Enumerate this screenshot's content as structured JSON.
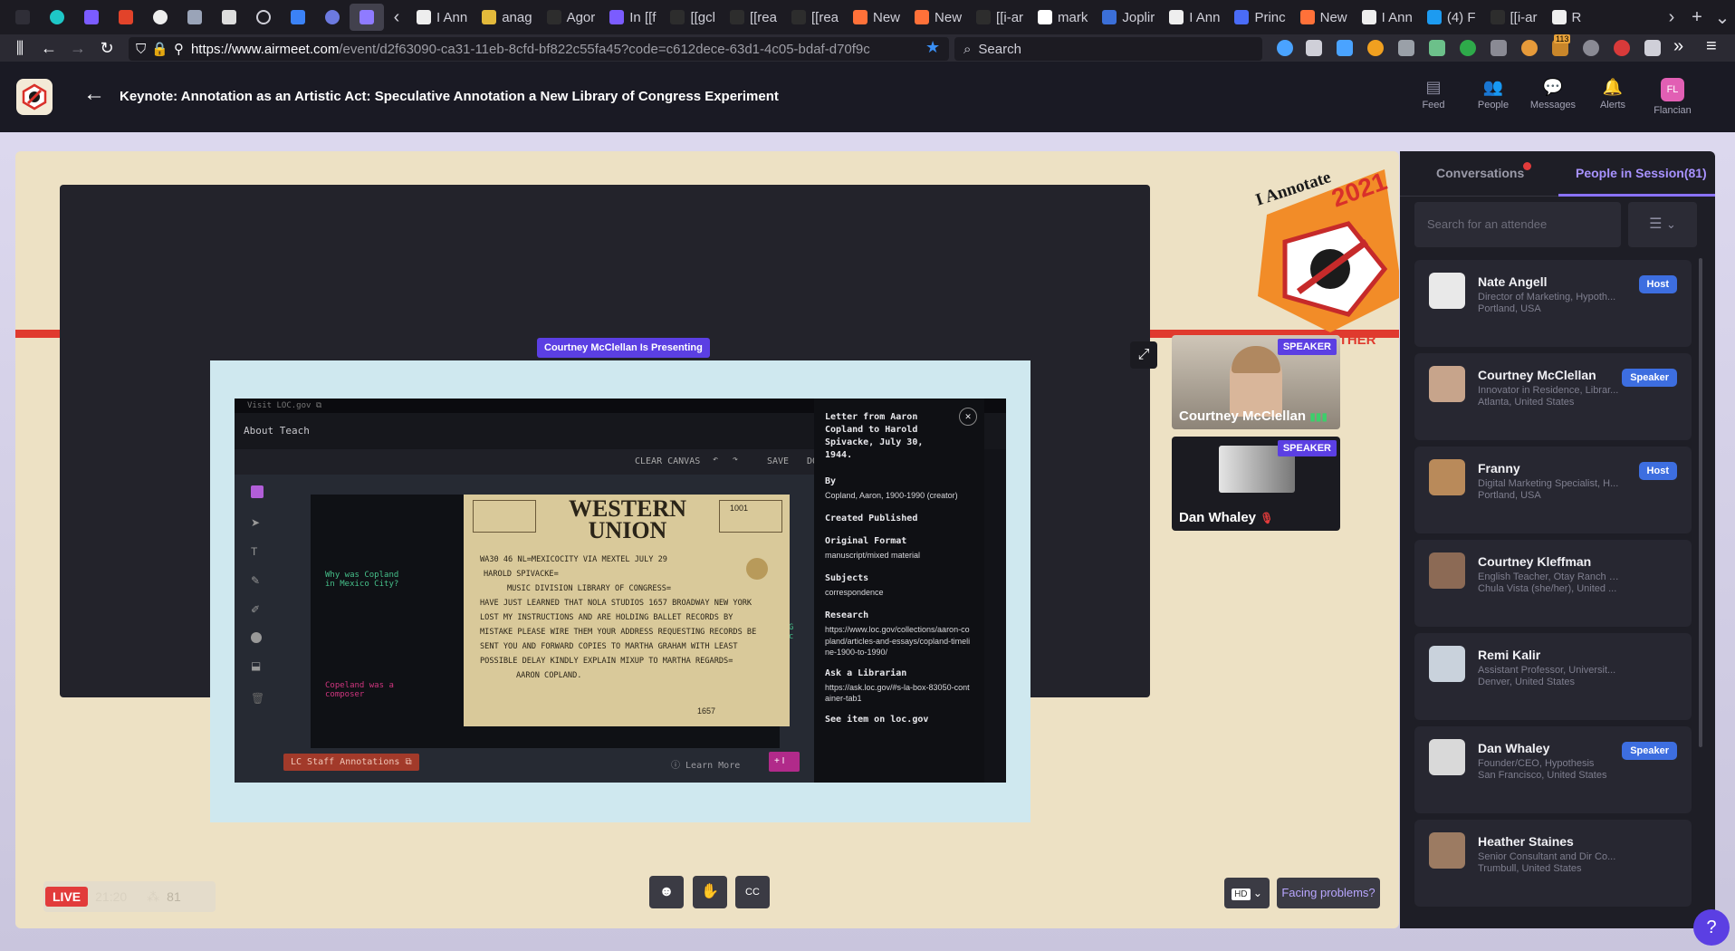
{
  "browser": {
    "tabs": [
      {
        "label": "I Ann",
        "active": false
      },
      {
        "label": "anag",
        "active": false
      },
      {
        "label": "Agor",
        "active": false
      },
      {
        "label": "In [[f",
        "active": false
      },
      {
        "label": "[[gcl",
        "active": false
      },
      {
        "label": "[[rea",
        "active": false
      },
      {
        "label": "[[rea",
        "active": false
      },
      {
        "label": "New",
        "active": false
      },
      {
        "label": "New",
        "active": false
      },
      {
        "label": "[[i-ar",
        "active": false
      },
      {
        "label": "mark",
        "active": false
      },
      {
        "label": "Joplir",
        "active": false
      },
      {
        "label": "I Ann",
        "active": false
      },
      {
        "label": "Princ",
        "active": false
      },
      {
        "label": "New",
        "active": false
      },
      {
        "label": "I Ann",
        "active": false
      },
      {
        "label": "(4) F",
        "active": false
      },
      {
        "label": "[[i-ar",
        "active": false
      },
      {
        "label": "R",
        "active": false
      }
    ],
    "url_main": "https://www.airmeet.com",
    "url_rest": "/event/d2f63090-ca31-11eb-8cfd-bf822c55fa45?code=c612dece-63d1-4c05-bdaf-d70f9c",
    "search_placeholder": "Search",
    "extension_badge": "113"
  },
  "header": {
    "title": "Keynote: Annotation as an Artistic Act: Speculative Annotation a New Library of Congress Experiment",
    "nav": [
      {
        "label": "Feed",
        "icon": "feed-icon"
      },
      {
        "label": "People",
        "icon": "people-icon"
      },
      {
        "label": "Messages",
        "icon": "messages-icon"
      },
      {
        "label": "Alerts",
        "icon": "bell-icon"
      },
      {
        "label": "Flancian",
        "icon": "profile-avatar",
        "initials": "FL"
      }
    ]
  },
  "stage": {
    "banner_text_2021": "2021",
    "banner_text_annotate": "I Annotate",
    "banner_gether": "GETHER",
    "presenting_label": "Courtney McClellan Is Presenting",
    "speakers": [
      {
        "name": "Courtney McClellan",
        "tag": "SPEAKER",
        "mic": "active"
      },
      {
        "name": "Dan Whaley",
        "tag": "SPEAKER",
        "mic": "muted"
      }
    ],
    "live_label": "LIVE",
    "elapsed": "21:20",
    "attendee_count": "81",
    "hd_label": "HD",
    "facing_problems": "Facing problems?"
  },
  "shared_screen": {
    "visit_link": "Visit LOC.gov",
    "nav_links": "About  Teach",
    "toolbar": {
      "clear": "CLEAR CANVAS",
      "save": "SAVE",
      "download": "DO"
    },
    "telegram_heading": "WESTERN UNION",
    "telegram_body": [
      "WA30 46 NL=MEXICOCITY VIA MEXTEL JULY 29",
      "HAROLD SPIVACKE=",
      "MUSIC DIVISION LIBRARY OF CONGRESS=",
      "HAVE JUST LEARNED THAT NOLA STUDIOS 1657 BROADWAY NEW YORK",
      "LOST MY INSTRUCTIONS AND ARE HOLDING BALLET RECORDS BY",
      "MISTAKE PLEASE WIRE THEM YOUR ADDRESS REQUESTING RECORDS BE",
      "SENT YOU AND FORWARD COPIES TO MARTHA GRAHAM WITH LEAST",
      "POSSIBLE DELAY KINDLY EXPLAIN MIXUP TO MARTHA REGARDS=",
      "AARON COPLAND."
    ],
    "note_left_1": "Why was Copland in Mexico City?",
    "note_left_2": "Copeland was a composer",
    "note_right": "Martha G dancer/c",
    "staff_annotations": "LC Staff Annotations",
    "learn_more": "Learn More",
    "sidebar": {
      "title": "Letter from Aaron Copland to Harold Spivacke, July 30, 1944.",
      "by_label": "By",
      "by_value": "Copland, Aaron, 1900-1990 (creator)",
      "created_label": "Created Published",
      "format_label": "Original Format",
      "format_value": "manuscript/mixed material",
      "subjects_label": "Subjects",
      "subjects_value": "correspondence",
      "research_label": "Research",
      "research_value": "https://www.loc.gov/collections/aaron-copland/articles-and-essays/copland-timeline-1900-to-1990/",
      "ask_label": "Ask a Librarian",
      "ask_value": "https://ask.loc.gov/#s-la-box-83050-container-tab1",
      "see_item": "See item on loc.gov"
    }
  },
  "panel": {
    "tab_conversations": "Conversations",
    "tab_people": "People in Session(81)",
    "search_placeholder": "Search for an attendee",
    "people": [
      {
        "name": "Nate Angell",
        "role": "Director of Marketing, Hypoth...",
        "location": "Portland, USA",
        "tag": "Host",
        "avatar_color": "#e9e9e9"
      },
      {
        "name": "Courtney McClellan",
        "role": "Innovator in Residence, Librar...",
        "location": "Atlanta, United States",
        "tag": "Speaker",
        "avatar_color": "#c7a48b"
      },
      {
        "name": "Franny",
        "role": "Digital Marketing Specialist, H...",
        "location": "Portland, USA",
        "tag": "Host",
        "avatar_color": "#b98a5a"
      },
      {
        "name": "Courtney Kleffman",
        "role": "English Teacher, Otay Ranch H...",
        "location": "Chula Vista (she/her), United ...",
        "tag": "",
        "avatar_color": "#8c6a55"
      },
      {
        "name": "Remi Kalir",
        "role": "Assistant Professor, Universit...",
        "location": "Denver, United States",
        "tag": "",
        "avatar_color": "#c9d2dc"
      },
      {
        "name": "Dan Whaley",
        "role": "Founder/CEO, Hypothesis",
        "location": "San Francisco, United States",
        "tag": "Speaker",
        "avatar_color": "#d9d9d9"
      },
      {
        "name": "Heather Staines",
        "role": "Senior Consultant and Dir Co...",
        "location": "Trumbull, United States",
        "tag": "",
        "avatar_color": "#9c7b62"
      }
    ]
  },
  "colors": {
    "accent": "#5b3fe3",
    "live": "#e23b3b",
    "tag_blue": "#3d6ee0",
    "stage_bg": "#ede1c4"
  }
}
